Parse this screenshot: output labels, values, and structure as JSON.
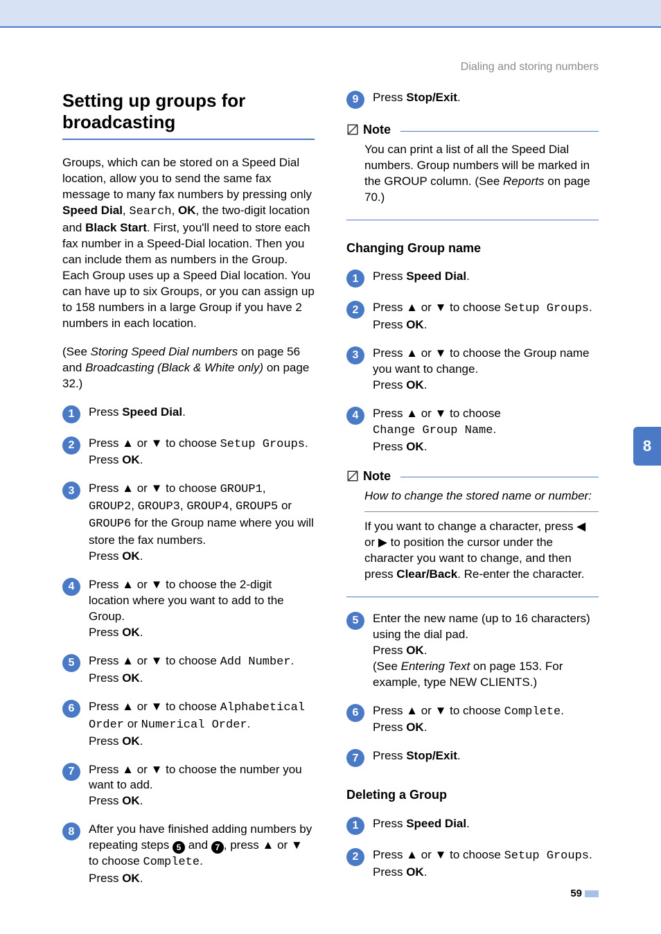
{
  "header": {
    "section": "Dialing and storing numbers"
  },
  "chapterTab": "8",
  "pageNumber": "59",
  "left": {
    "h1": "Setting up groups for broadcasting",
    "intro1_pre": "Groups, which can be stored on a Speed Dial location, allow you to send the same fax message to many fax numbers by pressing only ",
    "intro1_b1": "Speed Dial",
    "intro1_sep1": ", ",
    "intro1_mono1": "Search",
    "intro1_sep2": ", ",
    "intro1_b2": "OK",
    "intro1_mid": ", the two-digit location and ",
    "intro1_b3": "Black Start",
    "intro1_post": ". First, you'll need to store each fax number in a Speed-Dial location. Then you can include them as numbers in the Group. Each Group uses up a Speed Dial location. You can have up to six Groups, or you can assign up to 158 numbers in a large Group if you have 2 numbers in each location.",
    "intro2_pre": "(See ",
    "intro2_i1": "Storing Speed Dial numbers",
    "intro2_mid": " on page 56 and ",
    "intro2_i2": "Broadcasting (Black & White only)",
    "intro2_post": " on page 32.)",
    "steps": [
      {
        "n": "1",
        "pre": "Press ",
        "b1": "Speed Dial",
        "post": "."
      },
      {
        "n": "2",
        "pre": "Press ▲ or ▼ to choose ",
        "mono": "Setup Groups",
        "post": ".",
        "line2_pre": "Press ",
        "line2_b": "OK",
        "line2_post": "."
      },
      {
        "n": "3",
        "pre": "Press ▲ or ▼ to choose ",
        "mono": "GROUP1",
        "sep": ", ",
        "mono2": "GROUP2",
        "sep2": ", ",
        "mono3": "GROUP3",
        "sep3": ", ",
        "mono4": "GROUP4",
        "sep4": ", ",
        "mono5": "GROUP5",
        "mid": " or ",
        "mono6": "GROUP6",
        "post": " for the Group name where you will store the fax numbers.",
        "line2_pre": "Press ",
        "line2_b": "OK",
        "line2_post": "."
      },
      {
        "n": "4",
        "pre": "Press ▲ or ▼ to choose the 2-digit location where you want to add to the Group.",
        "line2_pre": "Press ",
        "line2_b": "OK",
        "line2_post": "."
      },
      {
        "n": "5",
        "pre": "Press ▲ or ▼ to choose ",
        "mono": "Add Number",
        "post": ".",
        "line2_pre": "Press ",
        "line2_b": "OK",
        "line2_post": "."
      },
      {
        "n": "6",
        "pre": "Press ▲ or ▼ to choose ",
        "mono": "Alphabetical Order",
        "mid": " or ",
        "mono2": "Numerical Order",
        "post": ".",
        "line2_pre": "Press ",
        "line2_b": "OK",
        "line2_post": "."
      },
      {
        "n": "7",
        "pre": "Press ▲ or ▼ to choose the number you want to add.",
        "line2_pre": "Press ",
        "line2_b": "OK",
        "line2_post": "."
      },
      {
        "n": "8",
        "pre": "After you have finished adding numbers by repeating steps ",
        "ref1": "5",
        "mid": " and ",
        "ref2": "7",
        "post": ", press ▲ or ▼ to choose ",
        "mono": "Complete",
        "post2": ".",
        "line2_pre": "Press ",
        "line2_b": "OK",
        "line2_post": "."
      }
    ]
  },
  "right": {
    "step9": {
      "n": "9",
      "pre": "Press ",
      "b1": "Stop/Exit",
      "post": "."
    },
    "note1": {
      "title": "Note",
      "body_pre": "You can print a list of all the Speed Dial numbers. Group numbers will be marked in the GROUP column. (See ",
      "body_i": "Reports",
      "body_post": " on page 70.)"
    },
    "h2a": "Changing Group name",
    "stepsA": [
      {
        "n": "1",
        "pre": "Press ",
        "b1": "Speed Dial",
        "post": "."
      },
      {
        "n": "2",
        "pre": "Press ▲ or ▼ to choose ",
        "mono": "Setup Groups",
        "post": ".",
        "line2_pre": "Press ",
        "line2_b": "OK",
        "line2_post": "."
      },
      {
        "n": "3",
        "pre": "Press ▲ or ▼ to choose the Group name you want to change.",
        "line2_pre": "Press ",
        "line2_b": "OK",
        "line2_post": "."
      },
      {
        "n": "4",
        "pre": "Press ▲ or ▼ to choose ",
        "mono": "Change Group Name",
        "post": ".",
        "line2_pre": "Press ",
        "line2_b": "OK",
        "line2_post": "."
      }
    ],
    "note2": {
      "title": "Note",
      "lead": "How to change the stored name or number:",
      "body_pre": "If you want to change a character, press ◀ or ▶ to position the cursor under the character you want to change, and then press ",
      "body_b": "Clear/Back",
      "body_post": ". Re-enter the character."
    },
    "stepsB": [
      {
        "n": "5",
        "pre": "Enter the new name (up to 16 characters) using the dial pad.",
        "line2_pre": "Press ",
        "line2_b": "OK",
        "line2_post": ".",
        "line3_pre": "(See ",
        "line3_i": "Entering Text",
        "line3_mid": " on page 153. For example, type NEW CLIENTS.)"
      },
      {
        "n": "6",
        "pre": "Press ▲ or ▼ to choose ",
        "mono": "Complete",
        "post": ".",
        "line2_pre": "Press ",
        "line2_b": "OK",
        "line2_post": "."
      },
      {
        "n": "7",
        "pre": "Press ",
        "b1": "Stop/Exit",
        "post": "."
      }
    ],
    "h2b": "Deleting a Group",
    "stepsC": [
      {
        "n": "1",
        "pre": "Press ",
        "b1": "Speed Dial",
        "post": "."
      },
      {
        "n": "2",
        "pre": "Press ▲ or ▼ to choose ",
        "mono": "Setup Groups",
        "post": ".",
        "line2_pre": "Press ",
        "line2_b": "OK",
        "line2_post": "."
      }
    ]
  }
}
